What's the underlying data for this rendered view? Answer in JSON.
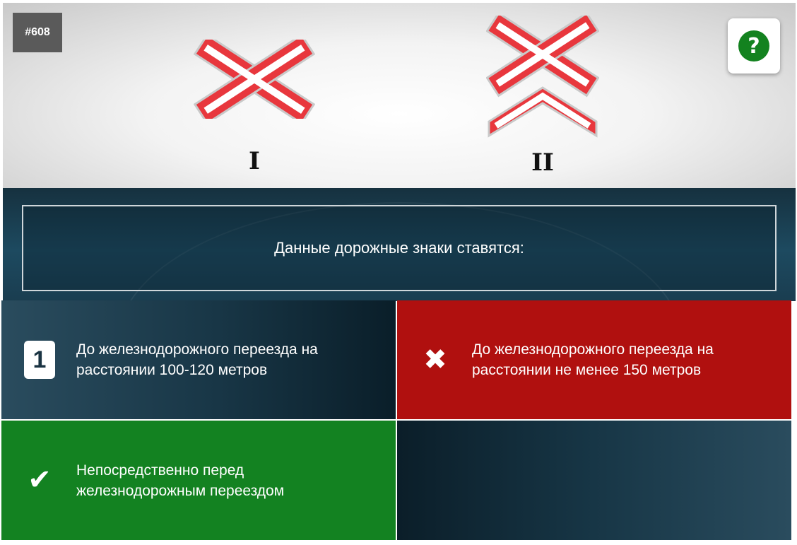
{
  "question": {
    "number": "#608",
    "text": "Данные дорожные знаки ставятся:",
    "sign_labels": [
      "I",
      "II"
    ],
    "help_symbol": "?"
  },
  "answers": [
    {
      "marker": "1",
      "marker_type": "number-badge",
      "text": "До железнодорожного переезда на расстоянии 100-120 метров",
      "state": "neutral"
    },
    {
      "marker": "✖",
      "marker_type": "cross-icon",
      "text": "До железнодорожного переезда на расстоянии не менее 150 метров",
      "state": "wrong"
    },
    {
      "marker": "✔",
      "marker_type": "check-icon",
      "text": "Непосредственно перед железнодорожным переездом",
      "state": "correct"
    },
    {
      "marker": "",
      "marker_type": "none",
      "text": "",
      "state": "empty"
    }
  ],
  "colors": {
    "wrong": "#b0100f",
    "correct": "#138221",
    "help_icon": "#13821f",
    "sign_red": "#e8373d"
  }
}
